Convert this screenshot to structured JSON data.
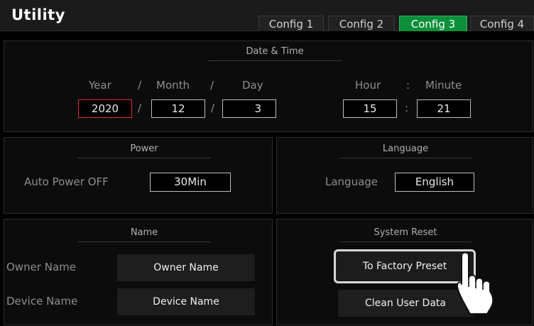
{
  "header": {
    "title": "Utility",
    "tabs": [
      {
        "label": "Config 1",
        "active": false
      },
      {
        "label": "Config 2",
        "active": false
      },
      {
        "label": "Config 3",
        "active": true
      },
      {
        "label": "Config 4",
        "active": false
      }
    ]
  },
  "date_time": {
    "title": "Date & Time",
    "year_label": "Year",
    "month_label": "Month",
    "day_label": "Day",
    "hour_label": "Hour",
    "minute_label": "Minute",
    "date_sep": "/",
    "time_sep": ":",
    "year": "2020",
    "month": "12",
    "day": "3",
    "hour": "15",
    "minute": "21"
  },
  "power": {
    "title": "Power",
    "auto_power_label": "Auto Power OFF",
    "auto_power_value": "30Min"
  },
  "language": {
    "title": "Language",
    "label": "Language",
    "value": "English"
  },
  "name": {
    "title": "Name",
    "owner_label": "Owner Name",
    "owner_value": "Owner Name",
    "device_label": "Device Name",
    "device_value": "Device Name"
  },
  "system_reset": {
    "title": "System Reset",
    "factory_preset_label": "To Factory Preset",
    "clean_user_data_label": "Clean User Data"
  },
  "colors": {
    "active_tab": "#0b8f3a",
    "highlight_border": "#e03030",
    "background": "#000000"
  },
  "icons": {
    "pointer": "hand-pointer-icon"
  }
}
